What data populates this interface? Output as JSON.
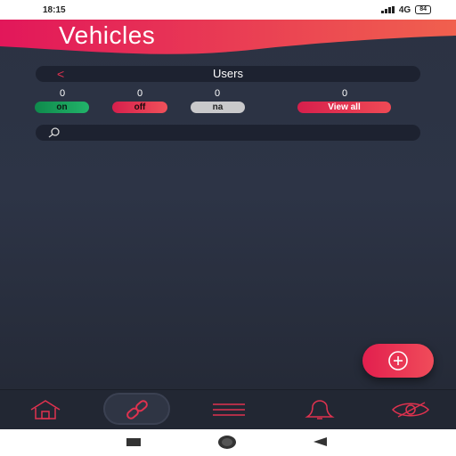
{
  "status_bar": {
    "time": "18:15",
    "network": "4G",
    "battery": "84"
  },
  "header": {
    "title": "Vehicles"
  },
  "users_bar": {
    "back_icon": "chevron-left-icon",
    "label": "Users"
  },
  "counts": {
    "on": {
      "count": "0",
      "label": "on"
    },
    "off": {
      "count": "0",
      "label": "off"
    },
    "na": {
      "count": "0",
      "label": "na"
    },
    "all": {
      "count": "0",
      "label": "View all"
    }
  },
  "search": {
    "placeholder": "",
    "value": "",
    "icon": "search-icon"
  },
  "fab": {
    "icon": "plus-circle-icon"
  },
  "bottom_nav": {
    "items": [
      {
        "icon": "home-icon",
        "active": false
      },
      {
        "icon": "link-icon",
        "active": true
      },
      {
        "icon": "menu-icon",
        "active": false
      },
      {
        "icon": "bell-icon",
        "active": false
      },
      {
        "icon": "eye-icon",
        "active": false
      }
    ]
  },
  "system_nav": {
    "items": [
      "recents-icon",
      "home-circle-icon",
      "back-triangle-icon"
    ]
  },
  "colors": {
    "accent": "#e21f4e",
    "accent_gradient_end": "#f0515a",
    "on_green": "#1aa35c",
    "na_gray": "#c9c9cb",
    "background": "#2b3242"
  }
}
